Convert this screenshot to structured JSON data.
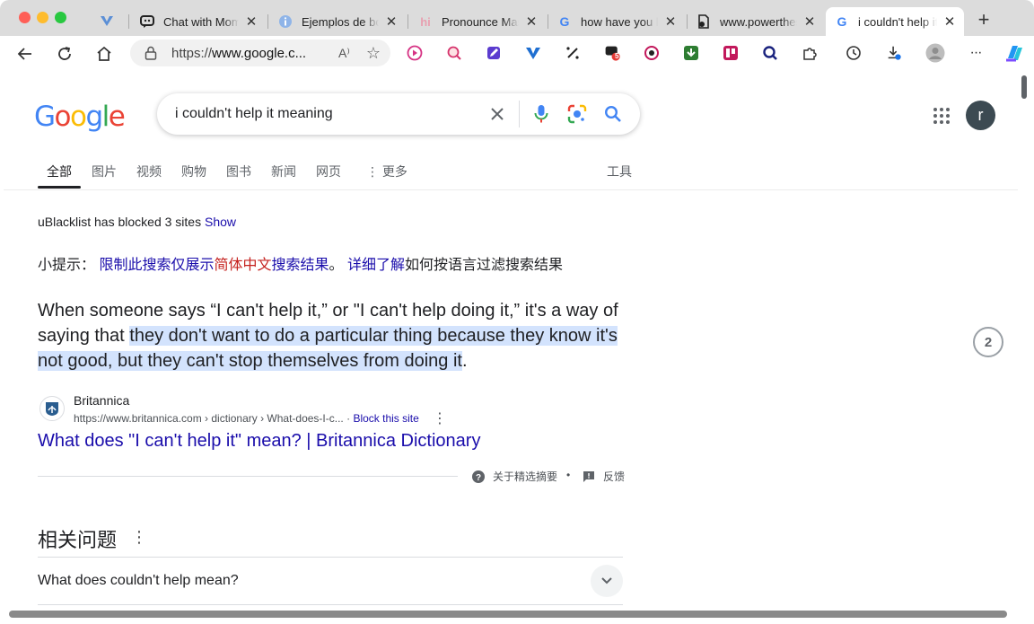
{
  "browser": {
    "tabs": [
      {
        "title": "Chat with Momm",
        "icon": "chat-icon"
      },
      {
        "title": "Ejemplos de bol",
        "icon": "info-icon"
      },
      {
        "title": "Pronounce Mast",
        "icon": "hi-icon"
      },
      {
        "title": "how have you b",
        "icon": "google-icon"
      },
      {
        "title": "www.powerthes",
        "icon": "doc-icon"
      },
      {
        "title": "i couldn't help it",
        "icon": "google-icon",
        "active": true
      }
    ],
    "new_tab": "+",
    "url_prefix": "https://",
    "url_host": "www.google.c...",
    "read_aloud": "A⁾",
    "download_badge": "5",
    "more": "···"
  },
  "google": {
    "logo": "Google",
    "logo_colors": [
      "#4285F4",
      "#EA4335",
      "#FBBC05",
      "#4285F4",
      "#34A853",
      "#EA4335"
    ],
    "query": "i couldn't help it meaning",
    "avatar_letter": "r",
    "nav": [
      "全部",
      "图片",
      "视频",
      "购物",
      "图书",
      "新闻",
      "网页",
      "更多"
    ],
    "tools": "工具",
    "ublacklist_text": "uBlacklist has blocked 3 sites",
    "ublacklist_show": "Show",
    "tip_prefix": "小提示：",
    "tip_link1": "限制此搜索仅展示",
    "tip_red": "简体中文",
    "tip_link2": "搜索结果",
    "tip_dot": "。",
    "tip_link3": "详细了解",
    "tip_suffix": "如何按语言过滤搜索结果",
    "snippet_start": "When someone says “I can't help it,” or \"I can't help doing it,” it's a way of saying that ",
    "snippet_highlight": "they don't want to do a particular thing because they know it's not good, but they can't stop themselves from doing it",
    "snippet_end": ".",
    "source_name": "Britannica",
    "source_cite": "https://www.britannica.com › dictionary › What-does-I-c...",
    "source_block": "Block this site",
    "result_title": "What does \"I can't help it\" mean? | Britannica Dictionary",
    "featured_about": "关于精选摘要",
    "feedback": "反馈",
    "paa_title": "相关问题",
    "paa_items": [
      "What does couldn't help mean?"
    ],
    "side_badge": "2"
  }
}
